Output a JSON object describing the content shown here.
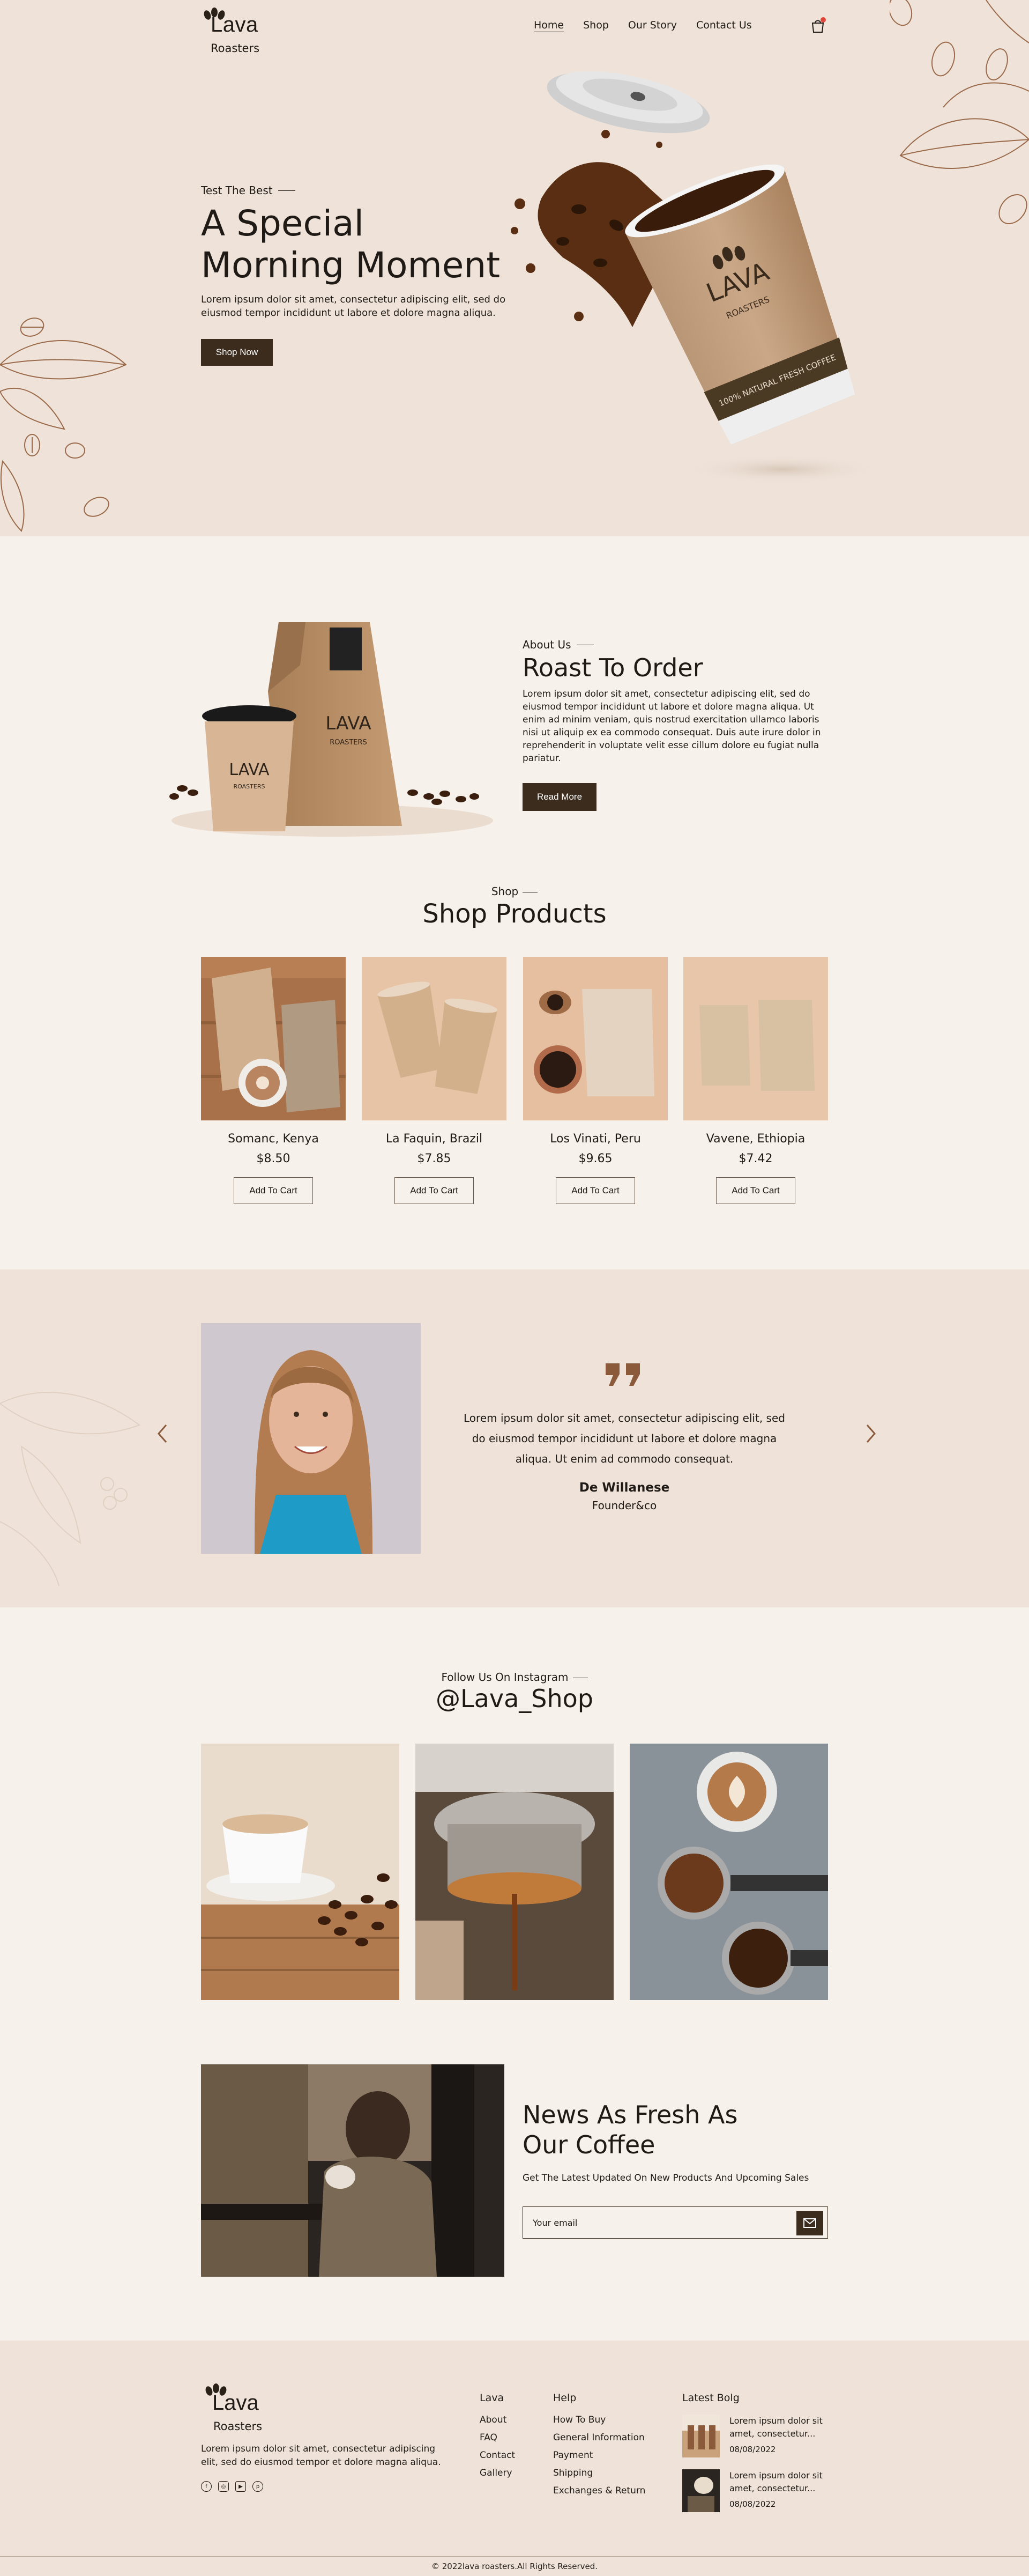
{
  "header": {
    "logo_word": "Lava",
    "logo_sub": "Roasters",
    "nav": [
      "Home",
      "Shop",
      "Our Story",
      "Contact Us"
    ],
    "cart_icon": "shopping-bag-icon"
  },
  "hero": {
    "eyebrow": "Test The Best",
    "title_line1": "A Special",
    "title_line2": "Morning Moment",
    "text": "Lorem ipsum dolor sit amet, consectetur adipiscing elit, sed do eiusmod tempor incididunt ut labore et dolore magna aliqua.",
    "button": "Shop Now",
    "cup_brand": "LAVA",
    "cup_sub": "ROASTERS",
    "cup_band": "100% NATURAL FRESH COFFEE"
  },
  "about": {
    "eyebrow": "About Us",
    "title": "Roast To Order",
    "text": "Lorem ipsum dolor sit amet, consectetur adipiscing elit, sed do eiusmod tempor incididunt ut labore et dolore magna aliqua. Ut enim ad minim veniam, quis nostrud exercitation ullamco laboris nisi ut aliquip ex ea commodo consequat. Duis aute irure dolor in reprehenderit in voluptate velit esse cillum dolore eu fugiat nulla pariatur.",
    "button": "Read More",
    "bag_brand": "LAVA",
    "bag_sub": "ROASTERS"
  },
  "shop": {
    "eyebrow": "Shop",
    "title": "Shop Products",
    "add_label": "Add To Cart",
    "products": [
      {
        "name": "Somanc, Kenya",
        "price": "$8.50"
      },
      {
        "name": "La Faquin, Brazil",
        "price": "$7.85"
      },
      {
        "name": "Los Vinati, Peru",
        "price": "$9.65"
      },
      {
        "name": "Vavene, Ethiopia",
        "price": "$7.42"
      }
    ]
  },
  "testimonial": {
    "quote": "Lorem ipsum dolor sit amet, consectetur adipiscing elit, sed do eiusmod tempor incididunt ut labore et dolore magna aliqua. Ut enim ad commodo consequat.",
    "name": "De Willanese",
    "role": "Founder&co"
  },
  "instagram": {
    "eyebrow": "Follow Us On Instagram",
    "handle": "@Lava_Shop"
  },
  "newsletter": {
    "title_line1": "News As Fresh As",
    "title_line2": "Our Coffee",
    "subtitle": "Get The Latest Updated On New Products And Upcoming Sales",
    "placeholder": "Your email"
  },
  "footer": {
    "logo_word": "Lava",
    "logo_sub": "Roasters",
    "about": "Lorem ipsum dolor sit amet, consectetur adipiscing elit, sed do eiusmod tempor et dolore magna aliqua.",
    "col1_title": "Lava",
    "col1": [
      "About",
      "FAQ",
      "Contact",
      "Gallery"
    ],
    "col2_title": "Help",
    "col2": [
      "How To Buy",
      "General Information",
      "Payment",
      "Shipping",
      "Exchanges & Return"
    ],
    "blog_title": "Latest Bolg",
    "blog": [
      {
        "line1": "Lorem ipsum dolor sit",
        "line2": "amet, consectetur...",
        "date": "08/08/2022"
      },
      {
        "line1": "Lorem ipsum dolor sit",
        "line2": "amet, consectetur...",
        "date": "08/08/2022"
      }
    ],
    "copyright": "© 2022lava roasters.All Rights Reserved."
  },
  "colors": {
    "hero_bg": "#efe3d9",
    "page_bg": "#f7f1eb",
    "dark_button": "#3b2c1d",
    "accent_brown": "#8a5a3b"
  }
}
